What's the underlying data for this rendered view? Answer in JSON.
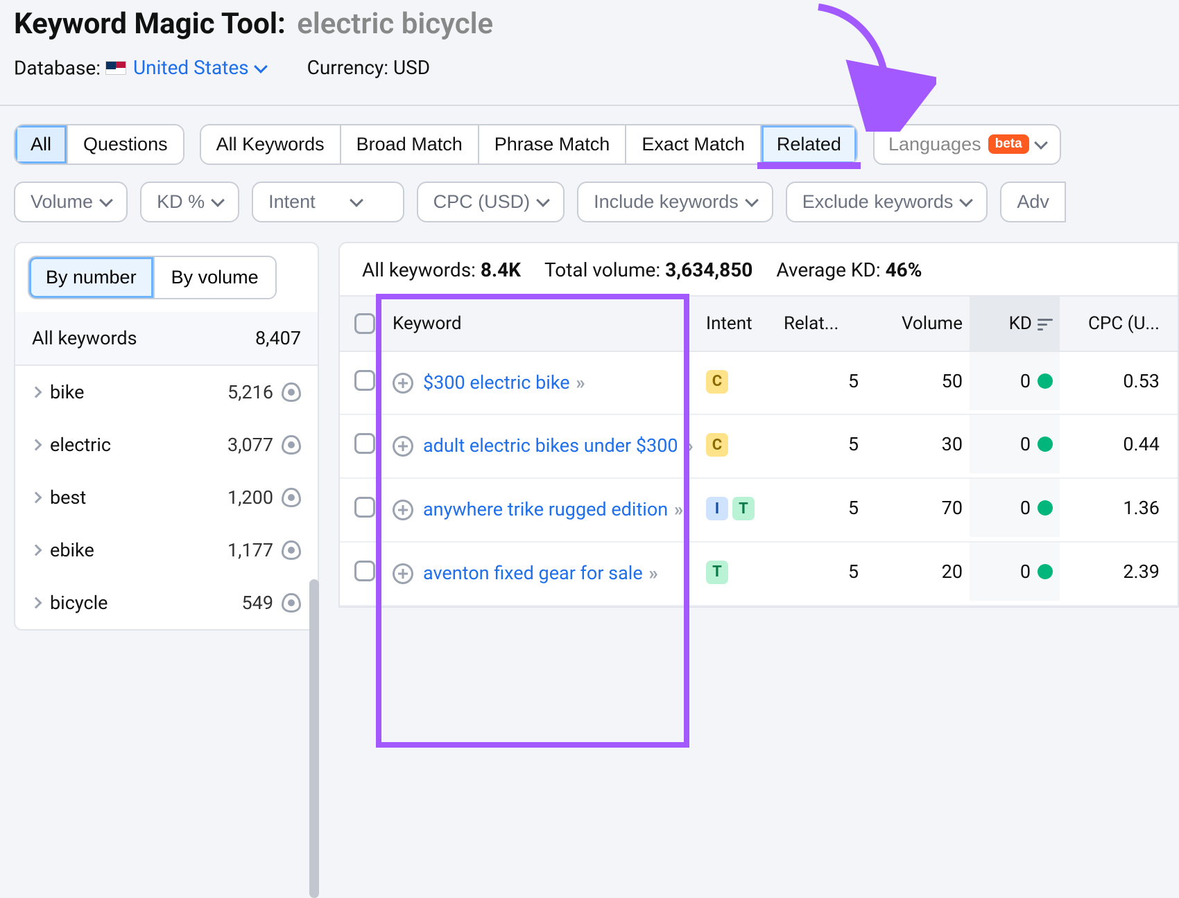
{
  "header": {
    "title_prefix": "Keyword Magic Tool:",
    "query": "electric bicycle",
    "database_label": "Database:",
    "database_value": "United States",
    "currency_label": "Currency: USD"
  },
  "tabs_primary": {
    "all": "All",
    "questions": "Questions"
  },
  "tabs_match": {
    "all_kw": "All Keywords",
    "broad": "Broad Match",
    "phrase": "Phrase Match",
    "exact": "Exact Match",
    "related": "Related"
  },
  "languages": {
    "label": "Languages",
    "badge": "beta"
  },
  "filters": {
    "volume": "Volume",
    "kd": "KD %",
    "intent": "Intent",
    "cpc": "CPC (USD)",
    "include": "Include keywords",
    "exclude": "Exclude keywords",
    "adv": "Adv"
  },
  "sidebar": {
    "by_number": "By number",
    "by_volume": "By volume",
    "all_label": "All keywords",
    "all_count": "8,407",
    "items": [
      {
        "label": "bike",
        "count": "5,216"
      },
      {
        "label": "electric",
        "count": "3,077"
      },
      {
        "label": "best",
        "count": "1,200"
      },
      {
        "label": "ebike",
        "count": "1,177"
      },
      {
        "label": "bicycle",
        "count": "549"
      }
    ]
  },
  "summary": {
    "all_kw_label": "All keywords:",
    "all_kw_value": "8.4K",
    "total_vol_label": "Total volume:",
    "total_vol_value": "3,634,850",
    "avg_kd_label": "Average KD:",
    "avg_kd_value": "46%"
  },
  "columns": {
    "keyword": "Keyword",
    "intent": "Intent",
    "related": "Relat...",
    "volume": "Volume",
    "kd": "KD",
    "cpc": "CPC (U..."
  },
  "rows": [
    {
      "kw": "$300 electric bike",
      "intents": [
        "C"
      ],
      "rel": "5",
      "vol": "50",
      "kd": "0",
      "cpc": "0.53"
    },
    {
      "kw": "adult electric bikes under $300",
      "intents": [
        "C"
      ],
      "rel": "5",
      "vol": "30",
      "kd": "0",
      "cpc": "0.44"
    },
    {
      "kw": "anywhere trike rugged edition",
      "intents": [
        "I",
        "T"
      ],
      "rel": "5",
      "vol": "70",
      "kd": "0",
      "cpc": "1.36"
    },
    {
      "kw": "aventon fixed gear for sale",
      "intents": [
        "T"
      ],
      "rel": "5",
      "vol": "20",
      "kd": "0",
      "cpc": "2.39"
    }
  ]
}
